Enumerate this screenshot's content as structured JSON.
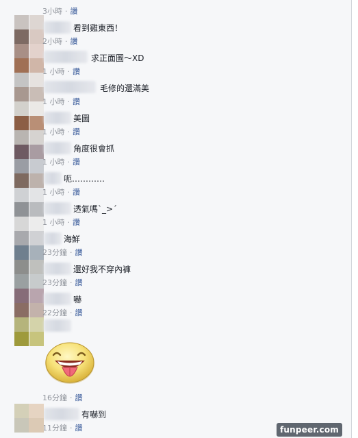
{
  "like_label": "讚",
  "separator": "·",
  "comments": [
    {
      "text": "",
      "time": "3小時"
    },
    {
      "text": "看到雞東西！",
      "time": "2小時"
    },
    {
      "text": "求正面圖～XD",
      "time": "1 小時"
    },
    {
      "text": "毛修的還滿美",
      "time": "1 小時"
    },
    {
      "text": "美圖",
      "time": "1 小時"
    },
    {
      "text": "角度很會抓",
      "time": "1 小時"
    },
    {
      "text": "呃…………",
      "time": "1 小時"
    },
    {
      "text": "透氣嗎ˋ_>ˊ",
      "time": "1 小時"
    },
    {
      "text": "海鮮",
      "time": "23分鐘"
    },
    {
      "text": "還好我不穿內褲",
      "time": "23分鐘"
    },
    {
      "text": "嚇",
      "time": "22分鐘"
    },
    {
      "text": "",
      "time": "16分鐘"
    },
    {
      "text": "有嚇到",
      "time": "11分鐘"
    }
  ],
  "sticker": {
    "icon": "tongue-out-smiley-icon"
  },
  "watermark": "funpeer.com",
  "colors": {
    "link": "#365899",
    "meta": "#90949c",
    "text": "#1d2129",
    "background": "#f6f7f9"
  }
}
